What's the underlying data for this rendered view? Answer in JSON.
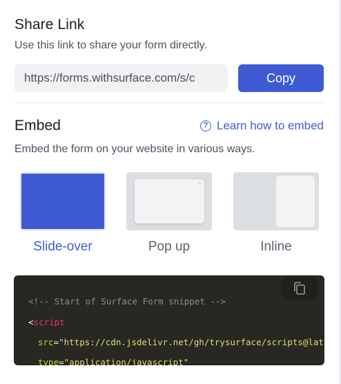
{
  "share": {
    "title": "Share Link",
    "subtitle": "Use this link to share your form directly.",
    "link_value": "https://forms.withsurface.com/s/c",
    "copy_label": "Copy"
  },
  "embed": {
    "title": "Embed",
    "learn_link": "Learn how to embed",
    "subtitle": "Embed the form on your website in various ways.",
    "options": [
      {
        "label": "Slide-over",
        "selected": true
      },
      {
        "label": "Pop up",
        "selected": false
      },
      {
        "label": "Inline",
        "selected": false
      }
    ]
  },
  "code": {
    "comment": "<!-- Start of Surface Form snippet -->",
    "lt": "<",
    "tag": "script",
    "src_attr": "src",
    "eq": "=",
    "src_value": "\"https://cdn.jsdelivr.net/gh/trysurface/scripts@lat",
    "type_attr": "type",
    "type_value": "\"application/javascript\""
  },
  "colors": {
    "accent": "#3f5bd4",
    "code_bg": "#272822"
  }
}
